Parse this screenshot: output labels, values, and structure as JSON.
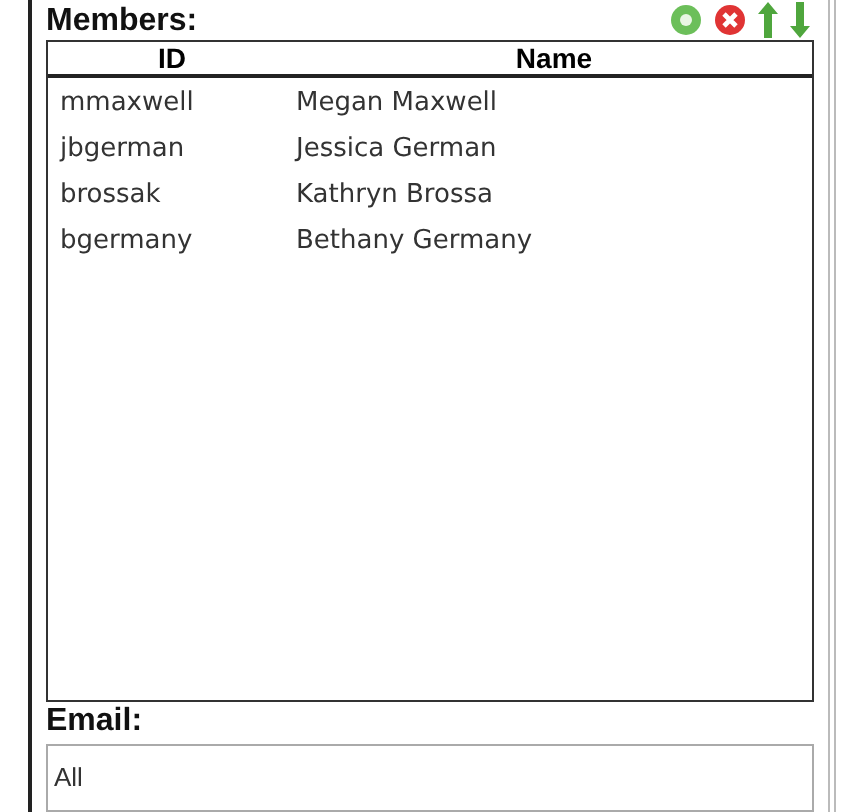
{
  "members": {
    "title": "Members:",
    "columns": [
      "ID",
      "Name"
    ],
    "rows": [
      [
        "mmaxwell",
        "Megan Maxwell"
      ],
      [
        "jbgerman",
        "Jessica German"
      ],
      [
        "brossak",
        "Kathryn Brossa"
      ],
      [
        "bgermany",
        "Bethany Germany"
      ]
    ]
  },
  "email": {
    "label": "Email:",
    "value": "All"
  }
}
